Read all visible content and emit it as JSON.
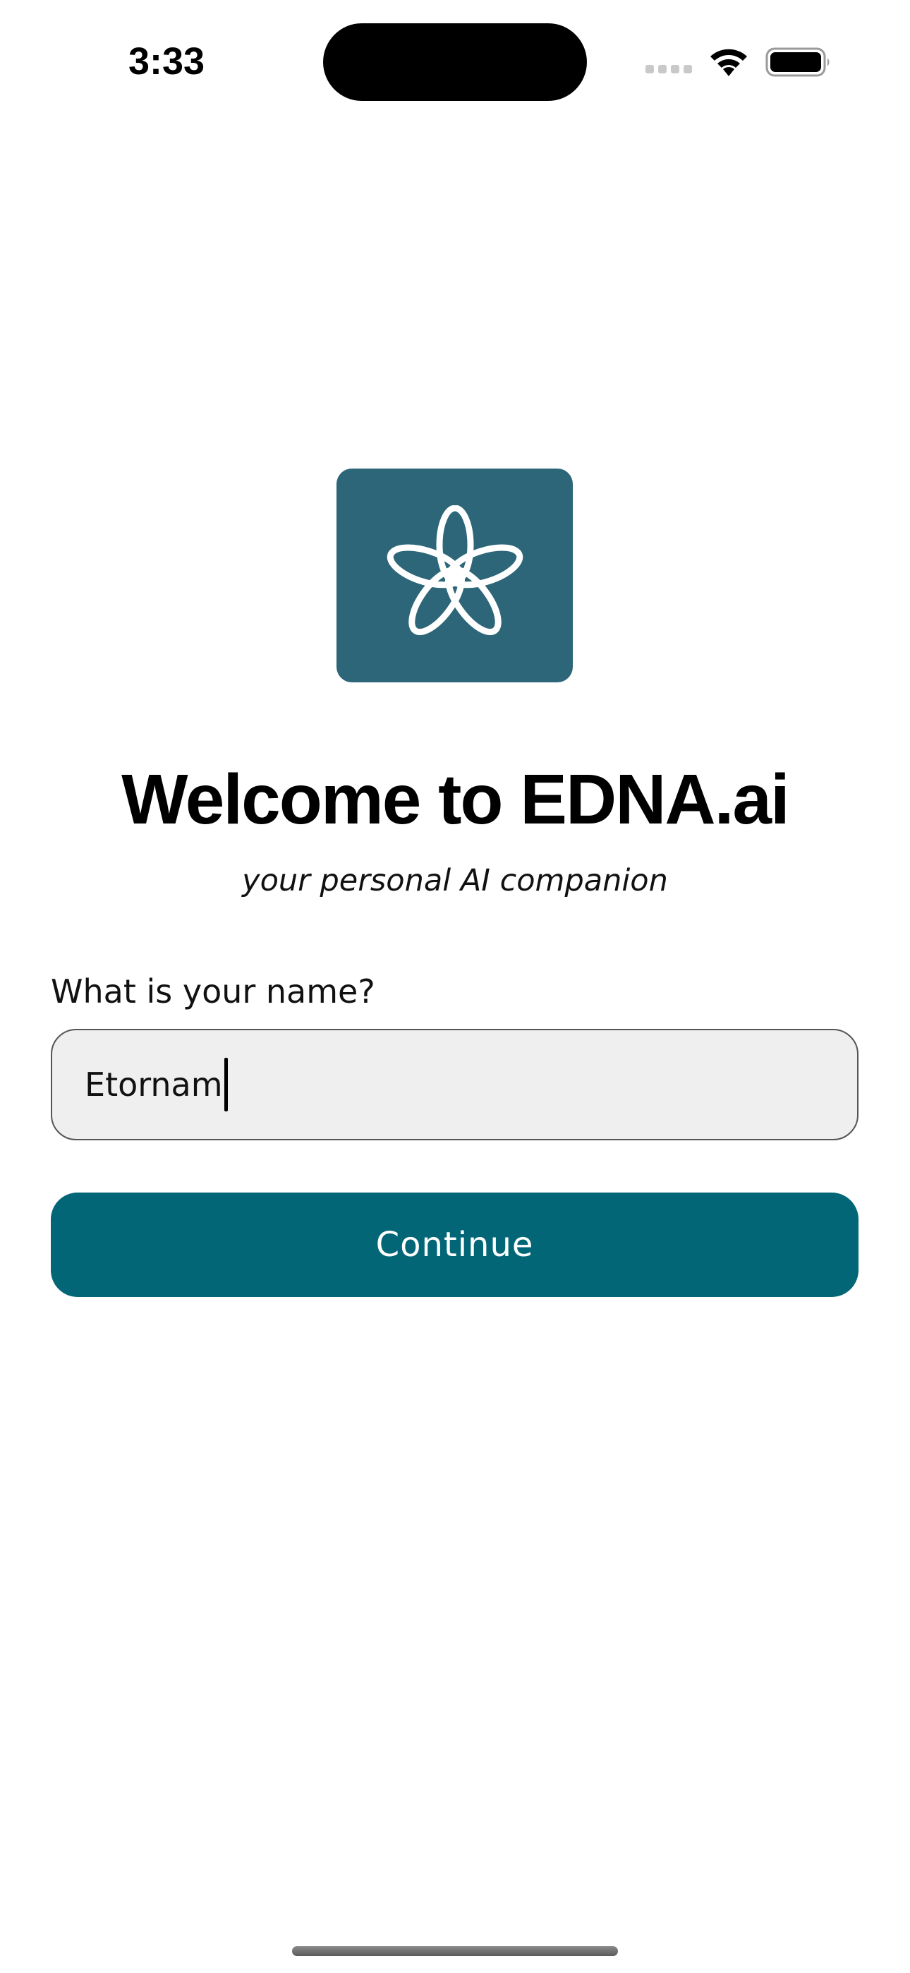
{
  "status_bar": {
    "time": "3:33",
    "wifi_icon": "wifi-icon",
    "battery_icon": "battery-icon",
    "signal_icon": "cellular-signal-icon"
  },
  "logo": {
    "icon": "edna-logo-icon",
    "tile_color": "#2c6678"
  },
  "welcome": {
    "title": "Welcome to EDNA.ai",
    "subtitle": "your personal AI companion"
  },
  "name_form": {
    "label": "What is your name?",
    "value": "Etornam",
    "field_background": "#efefef"
  },
  "continue_button": {
    "label": "Continue",
    "color": "#026677"
  }
}
